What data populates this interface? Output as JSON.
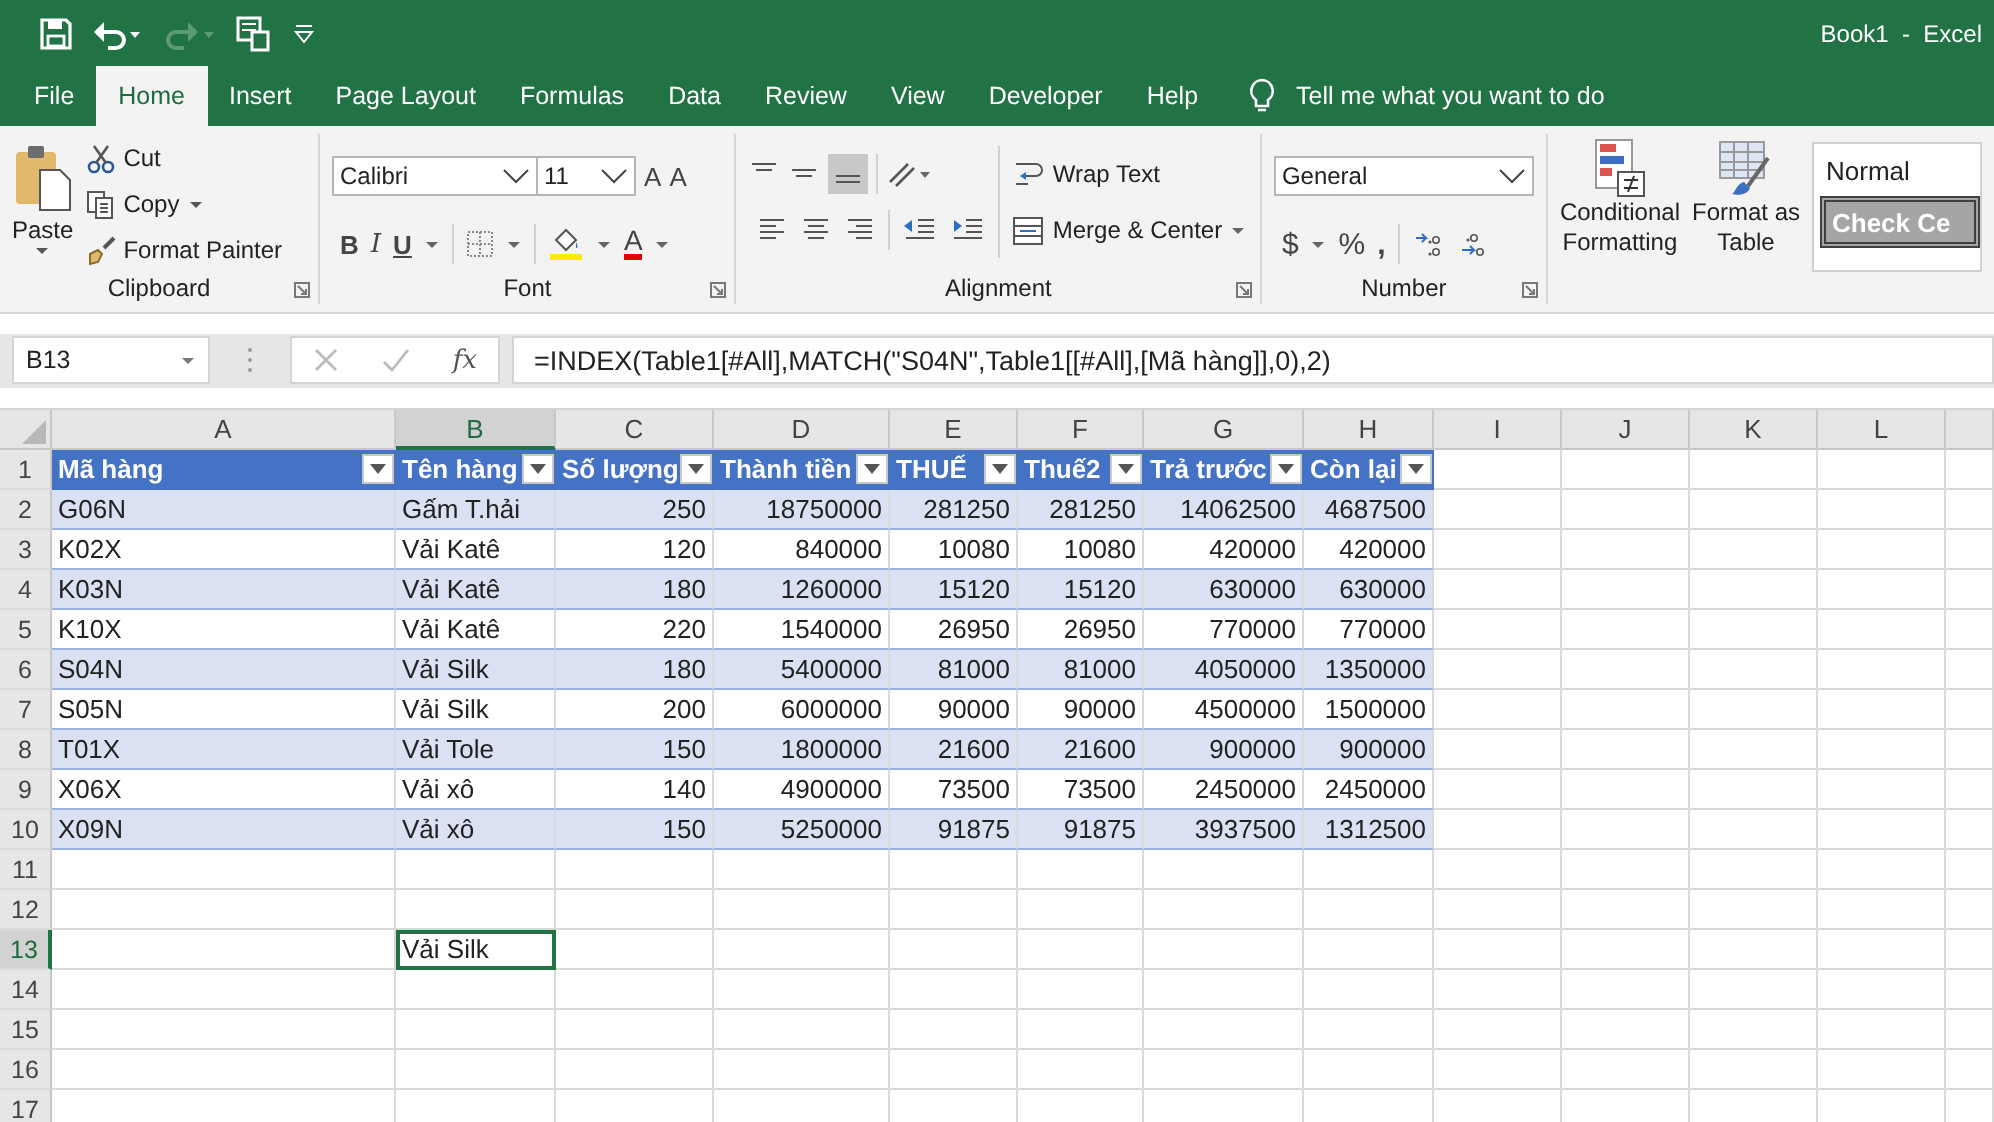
{
  "window": {
    "title": "Book1  -  Excel"
  },
  "tabs": [
    {
      "label": "File",
      "selected": false
    },
    {
      "label": "Home",
      "selected": true
    },
    {
      "label": "Insert",
      "selected": false
    },
    {
      "label": "Page Layout",
      "selected": false
    },
    {
      "label": "Formulas",
      "selected": false
    },
    {
      "label": "Data",
      "selected": false
    },
    {
      "label": "Review",
      "selected": false
    },
    {
      "label": "View",
      "selected": false
    },
    {
      "label": "Developer",
      "selected": false
    },
    {
      "label": "Help",
      "selected": false
    }
  ],
  "tell_me": "Tell me what you want to do",
  "clipboard": {
    "paste": "Paste",
    "cut": "Cut",
    "copy": "Copy",
    "format_painter": "Format Painter",
    "label": "Clipboard"
  },
  "font": {
    "font_name": "Calibri",
    "font_size": "11",
    "grow": "A",
    "shrink": "A",
    "bold": "B",
    "italic": "I",
    "underline": "U",
    "font_color": "A",
    "label": "Font"
  },
  "alignment": {
    "wrap_text": "Wrap Text",
    "merge_center": "Merge & Center",
    "label": "Alignment"
  },
  "number": {
    "format": "General",
    "currency": "$",
    "percent": "%",
    "comma": ",",
    "label": "Number"
  },
  "styles": {
    "conditional_formatting": [
      "Conditional",
      "Formatting"
    ],
    "format_as_table": [
      "Format as",
      "Table"
    ],
    "normal": "Normal",
    "check_cell": "Check Ce"
  },
  "formula_bar": {
    "name_box": "B13",
    "function_label": "fx",
    "formula": "=INDEX(Table1[#All],MATCH(\"S04N\",Table1[[#All],[Mã hàng]],0),2)"
  },
  "columns": [
    {
      "letter": "A",
      "selected": false
    },
    {
      "letter": "B",
      "selected": true
    },
    {
      "letter": "C",
      "selected": false
    },
    {
      "letter": "D",
      "selected": false
    },
    {
      "letter": "E",
      "selected": false
    },
    {
      "letter": "F",
      "selected": false
    },
    {
      "letter": "G",
      "selected": false
    },
    {
      "letter": "H",
      "selected": false
    },
    {
      "letter": "I",
      "selected": false
    },
    {
      "letter": "J",
      "selected": false
    },
    {
      "letter": "K",
      "selected": false
    },
    {
      "letter": "L",
      "selected": false
    }
  ],
  "table": {
    "header": {
      "number": "1",
      "selected": false
    },
    "columns": [
      {
        "label": "Mã hàng",
        "kind": "text"
      },
      {
        "label": "Tên hàng",
        "kind": "text"
      },
      {
        "label": "Số lượng",
        "kind": "number"
      },
      {
        "label": "Thành tiền",
        "kind": "number"
      },
      {
        "label": "THUẾ",
        "kind": "number"
      },
      {
        "label": "Thuế2",
        "kind": "number"
      },
      {
        "label": "Trả trước",
        "kind": "number"
      },
      {
        "label": "Còn lại",
        "kind": "number"
      }
    ],
    "rows": [
      {
        "number": "2",
        "selected": false,
        "cells": [
          "G06N",
          "Gấm T.hải",
          "250",
          "18750000",
          "281250",
          "281250",
          "14062500",
          "4687500"
        ]
      },
      {
        "number": "3",
        "selected": false,
        "cells": [
          "K02X",
          "Vải Katê",
          "120",
          "840000",
          "10080",
          "10080",
          "420000",
          "420000"
        ]
      },
      {
        "number": "4",
        "selected": false,
        "cells": [
          "K03N",
          "Vải Katê",
          "180",
          "1260000",
          "15120",
          "15120",
          "630000",
          "630000"
        ]
      },
      {
        "number": "5",
        "selected": false,
        "cells": [
          "K10X",
          "Vải Katê",
          "220",
          "1540000",
          "26950",
          "26950",
          "770000",
          "770000"
        ]
      },
      {
        "number": "6",
        "selected": false,
        "cells": [
          "S04N",
          "Vải Silk",
          "180",
          "5400000",
          "81000",
          "81000",
          "4050000",
          "1350000"
        ]
      },
      {
        "number": "7",
        "selected": false,
        "cells": [
          "S05N",
          "Vải Silk",
          "200",
          "6000000",
          "90000",
          "90000",
          "4500000",
          "1500000"
        ]
      },
      {
        "number": "8",
        "selected": false,
        "cells": [
          "T01X",
          "Vải Tole",
          "150",
          "1800000",
          "21600",
          "21600",
          "900000",
          "900000"
        ]
      },
      {
        "number": "9",
        "selected": false,
        "cells": [
          "X06X",
          "Vải xô",
          "140",
          "4900000",
          "73500",
          "73500",
          "2450000",
          "2450000"
        ]
      },
      {
        "number": "10",
        "selected": false,
        "cells": [
          "X09N",
          "Vải xô",
          "150",
          "5250000",
          "91875",
          "91875",
          "3937500",
          "1312500"
        ]
      }
    ]
  },
  "rows_below": [
    {
      "number": "11",
      "selected": false
    },
    {
      "number": "12",
      "selected": false
    },
    {
      "number": "13",
      "selected": true,
      "cell_b": {
        "value": "Vải Silk",
        "selected": true
      }
    },
    {
      "number": "14",
      "selected": false
    },
    {
      "number": "15",
      "selected": false
    },
    {
      "number": "16",
      "selected": false
    },
    {
      "number": "17",
      "selected": false
    }
  ]
}
